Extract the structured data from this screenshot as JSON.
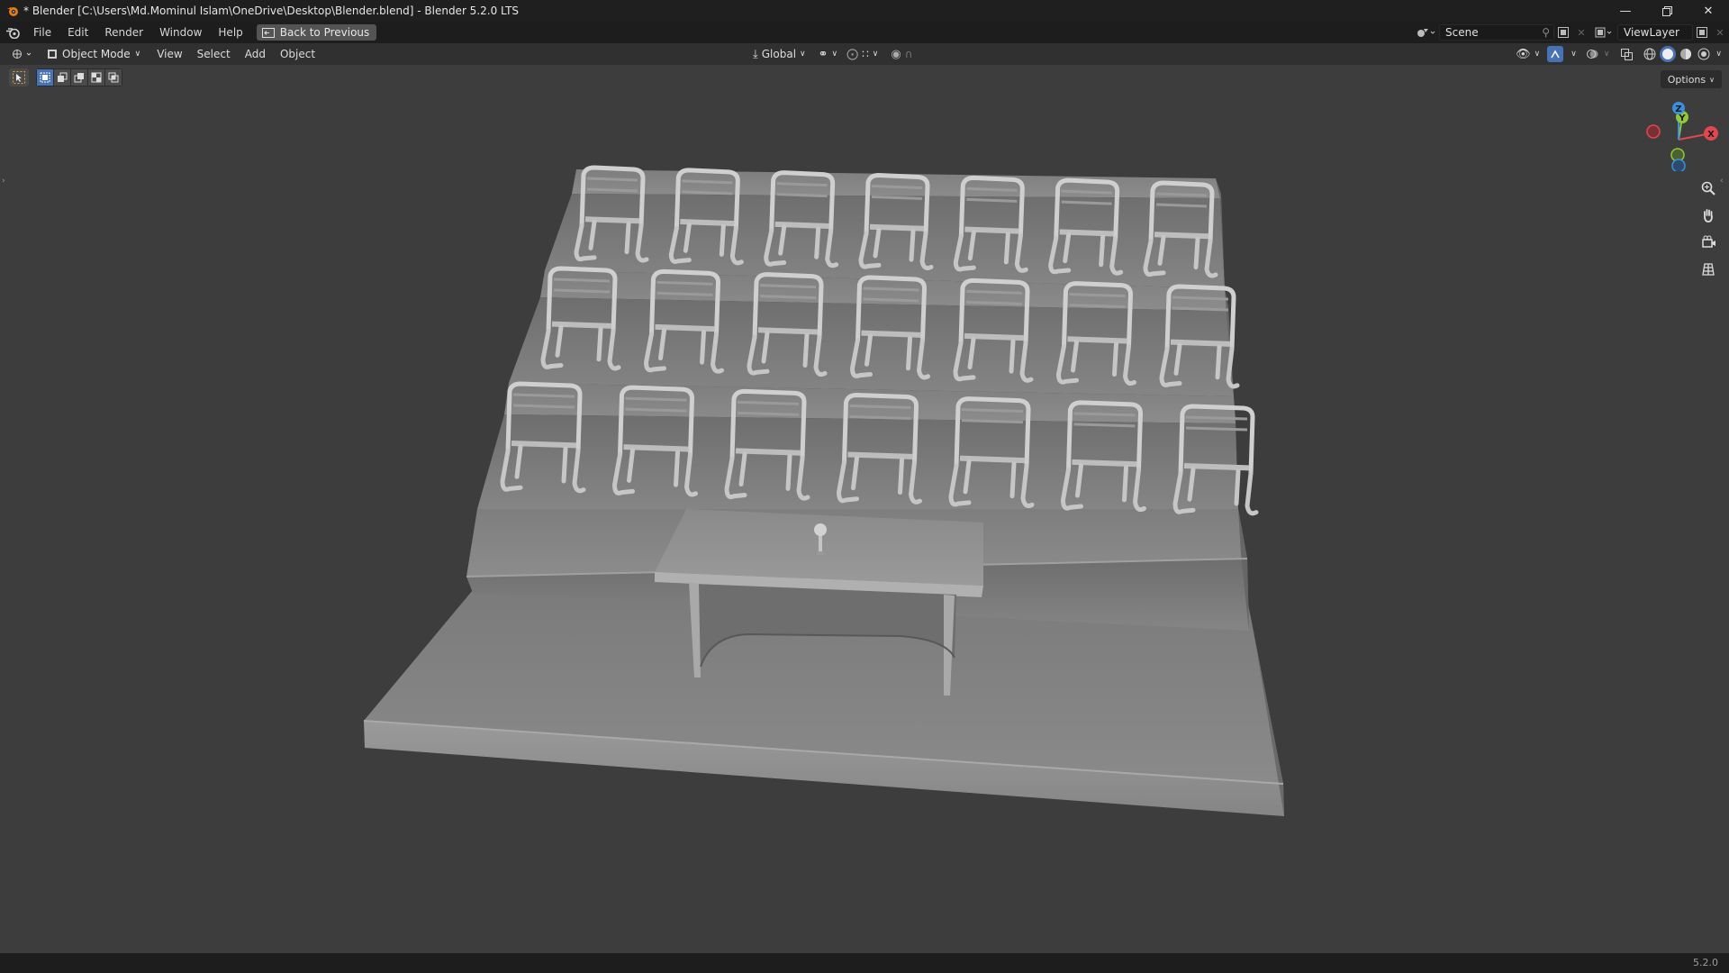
{
  "window": {
    "title": "* Blender [C:\\Users\\Md.Mominul Islam\\OneDrive\\Desktop\\Blender.blend] - Blender 5.2.0 LTS",
    "controls": [
      "minimize-icon",
      "restore-icon",
      "close-icon"
    ]
  },
  "topbar": {
    "menus": [
      "File",
      "Edit",
      "Render",
      "Window",
      "Help"
    ],
    "back_button": "Back to Previous",
    "scene": "Scene",
    "view_layer": "ViewLayer"
  },
  "viewport_header": {
    "mode": "Object Mode",
    "menus": [
      "View",
      "Select",
      "Add",
      "Object"
    ],
    "transform_orientation": "Global",
    "options_label": "Options"
  },
  "scene_objects": {
    "rows_of_chairs": 3,
    "chairs_per_row": 7,
    "desk": "present",
    "microphone": "present"
  },
  "colors": {
    "accent": "#4772b3",
    "viewport_bg": "#3d3d3d",
    "axis_x": "#e0474f",
    "axis_y": "#8fc93a",
    "axis_z": "#3b8fdc"
  },
  "gizmo": {
    "x_label": "X",
    "y_label": "Y",
    "z_label": "Z"
  },
  "nav_icons": [
    "zoom-icon",
    "pan-hand-icon",
    "camera-view-icon",
    "ortho-grid-icon"
  ],
  "status": {
    "version": "5.2.0"
  }
}
